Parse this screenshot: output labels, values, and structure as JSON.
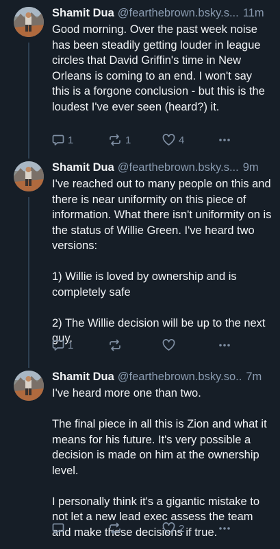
{
  "posts": [
    {
      "author": "Shamit Dua",
      "handle": "@fearthebrown.bsky.s...",
      "time": "11m",
      "paragraphs": [
        "Good morning. Over the past week noise has been steadily getting louder in league circles that David Griffin's time in New Orleans is coming to an end. I won't say this is a forgone conclusion - but this is the loudest I've ever seen (heard?) it."
      ],
      "replies": "1",
      "reposts": "1",
      "likes": "4"
    },
    {
      "author": "Shamit Dua",
      "handle": "@fearthebrown.bsky.s...",
      "time": "9m",
      "paragraphs": [
        "I've reached out to many people on this and there is near uniformity on this piece of information. What there isn't uniformity on is the status of Willie Green. I've heard two versions:",
        "1) Willie is loved by ownership and is completely safe",
        "2) The Willie decision will be up to the next guy."
      ],
      "replies": "1",
      "reposts": "",
      "likes": ""
    },
    {
      "author": "Shamit Dua",
      "handle": "@fearthebrown.bsky.so..",
      "time": "7m",
      "paragraphs": [
        "I've heard more one than two.",
        "The final piece in all this is Zion and what it means for his future. It's very possible a decision is made on him at the ownership level.",
        "I personally think it's a gigantic mistake to not let a new lead exec assess the team and make these decisions if true."
      ],
      "replies": "",
      "reposts": "",
      "likes": "2"
    }
  ],
  "icons": {
    "reply": "speech-bubble-icon",
    "repost": "repost-arrows-icon",
    "like": "heart-outline-icon",
    "more": "ellipsis-icon"
  },
  "colors": {
    "background": "#161e27",
    "text": "#f1f3f5",
    "muted": "#8a9bb0",
    "thread_line": "#2e4052"
  }
}
